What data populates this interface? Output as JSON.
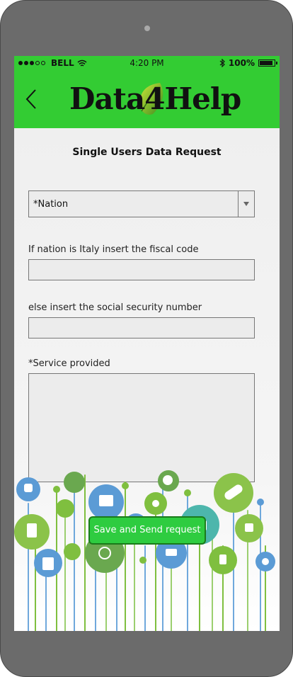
{
  "statusbar": {
    "carrier": "BELL",
    "time": "4:20 PM",
    "battery_text": "100%",
    "battery_level": 1.0
  },
  "header": {
    "logo_text": "Data4Help",
    "brand_color": "#33cc33"
  },
  "form": {
    "title": "Single Users Data Request",
    "nation_select": {
      "value": "*Nation"
    },
    "fiscal_code_label": "If nation is Italy insert the fiscal code",
    "fiscal_code_value": "",
    "ssn_label": "else insert the social security number",
    "ssn_value": "",
    "service_label": "*Service provided",
    "service_value": "",
    "save_label": "Save and Send request"
  },
  "icons": [
    "back-chevron-icon",
    "wifi-icon",
    "bluetooth-icon",
    "battery-icon",
    "dropdown-arrow-icon"
  ]
}
